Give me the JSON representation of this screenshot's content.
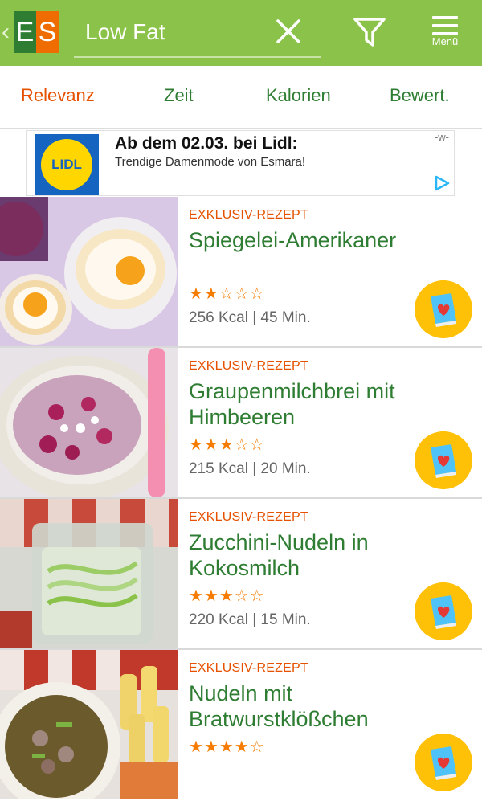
{
  "header": {
    "search_value": "Low Fat",
    "menu_label": "Menü",
    "logo": "ES"
  },
  "sort_tabs": [
    "Relevanz",
    "Zeit",
    "Kalorien",
    "Bewert."
  ],
  "ad": {
    "logo_text": "LIDL",
    "title": "Ab dem 02.03. bei Lidl:",
    "subtitle": "Trendige Damenmode von Esmara!",
    "tag": "-w-"
  },
  "recipes": [
    {
      "label": "EXKLUSIV-REZEPT",
      "title": "Spiegelei-Amerikaner",
      "stars": "★★☆☆☆",
      "meta": "256 Kcal | 45 Min."
    },
    {
      "label": "EXKLUSIV-REZEPT",
      "title": "Graupenmilchbrei mit Himbeeren",
      "stars": "★★★☆☆",
      "meta": "215 Kcal | 20 Min."
    },
    {
      "label": "EXKLUSIV-REZEPT",
      "title": "Zucchini-Nudeln in Kokosmilch",
      "stars": "★★★☆☆",
      "meta": "220 Kcal | 15 Min."
    },
    {
      "label": "EXKLUSIV-REZEPT",
      "title": "Nudeln mit Bratwurstklößchen",
      "stars": "★★★★☆",
      "meta": ""
    }
  ],
  "colors": {
    "header_green": "#8bc34a",
    "title_green": "#2e7d32",
    "accent_orange": "#e65100",
    "badge_yellow": "#ffc107"
  }
}
